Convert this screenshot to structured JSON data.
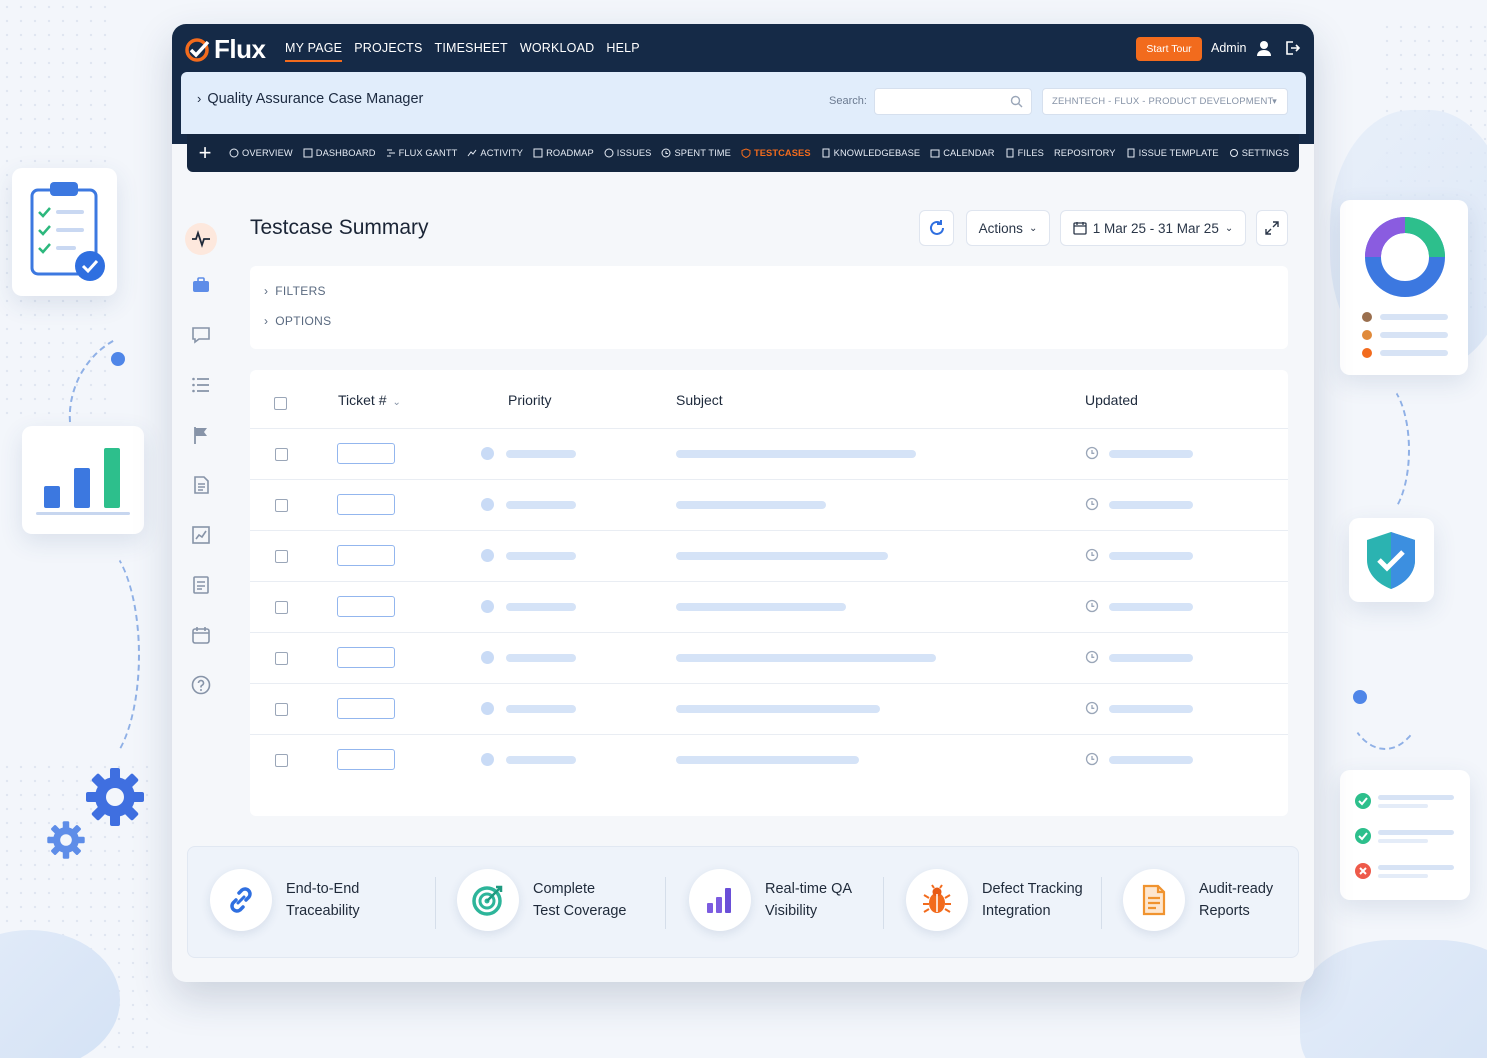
{
  "brand": {
    "name": "Flux",
    "accent": "#f26b1d",
    "navy": "#152a47"
  },
  "topnav": {
    "items": [
      "MY PAGE",
      "PROJECTS",
      "TIMESHEET",
      "WORKLOAD",
      "HELP"
    ],
    "active": "MY PAGE",
    "start_tour": "Start Tour",
    "user": "Admin",
    "icons": [
      "user-icon",
      "logout-icon"
    ]
  },
  "project": {
    "breadcrumb": "Quality Assurance Case Manager",
    "search_label": "Search:",
    "search_value": "",
    "selector": "ZEHNTECH - FLUX - PRODUCT DEVELOPMENT"
  },
  "modules": {
    "add": "+",
    "items": [
      "OVERVIEW",
      "DASHBOARD",
      "FLUX GANTT",
      "ACTIVITY",
      "ROADMAP",
      "ISSUES",
      "SPENT TIME",
      "TESTCASES",
      "KNOWLEDGEBASE",
      "CALENDAR",
      "FILES",
      "REPOSITORY",
      "ISSUE TEMPLATE",
      "SETTINGS"
    ],
    "active": "TESTCASES"
  },
  "sidebar": {
    "icons": [
      "activity-icon",
      "briefcase-icon",
      "chat-icon",
      "list-icon",
      "flag-icon",
      "document-icon",
      "chart-icon",
      "report-icon",
      "calendar-icon",
      "help-icon"
    ]
  },
  "page": {
    "title": "Testcase Summary",
    "actions_label": "Actions",
    "date_range": "1 Mar 25 - 31 Mar 25",
    "filters_label": "FILTERS",
    "options_label": "OPTIONS"
  },
  "table": {
    "columns": [
      "Ticket #",
      "Priority",
      "Subject",
      "Updated"
    ],
    "row_count": 7
  },
  "features": [
    {
      "line1": "End-to-End",
      "line2": "Traceability",
      "icon": "link-icon"
    },
    {
      "line1": "Complete",
      "line2": "Test Coverage",
      "icon": "target-icon"
    },
    {
      "line1": "Real-time QA",
      "line2": "Visibility",
      "icon": "bar-chart-icon"
    },
    {
      "line1": "Defect Tracking",
      "line2": "Integration",
      "icon": "bug-icon"
    },
    {
      "line1": "Audit-ready",
      "line2": "Reports",
      "icon": "report-icon"
    }
  ]
}
